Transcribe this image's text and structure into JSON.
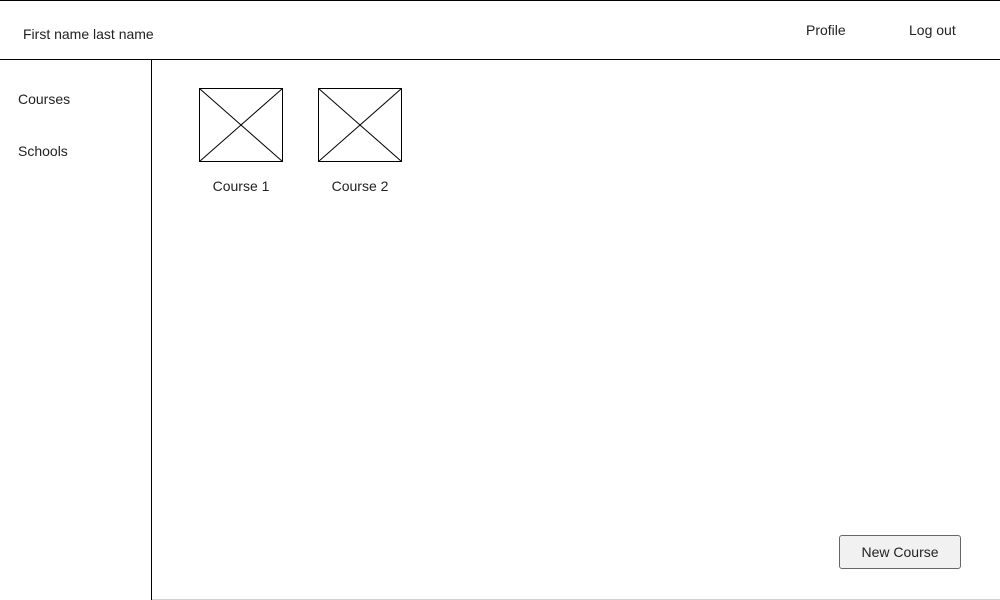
{
  "header": {
    "user_name": "First name last name",
    "nav": {
      "profile": "Profile",
      "logout": "Log out"
    }
  },
  "sidebar": {
    "items": [
      {
        "label": "Courses"
      },
      {
        "label": "Schools"
      }
    ]
  },
  "main": {
    "courses": [
      {
        "label": "Course 1",
        "thumbnail_icon": "image-placeholder-icon"
      },
      {
        "label": "Course 2",
        "thumbnail_icon": "image-placeholder-icon"
      }
    ],
    "new_course_label": "New Course"
  }
}
